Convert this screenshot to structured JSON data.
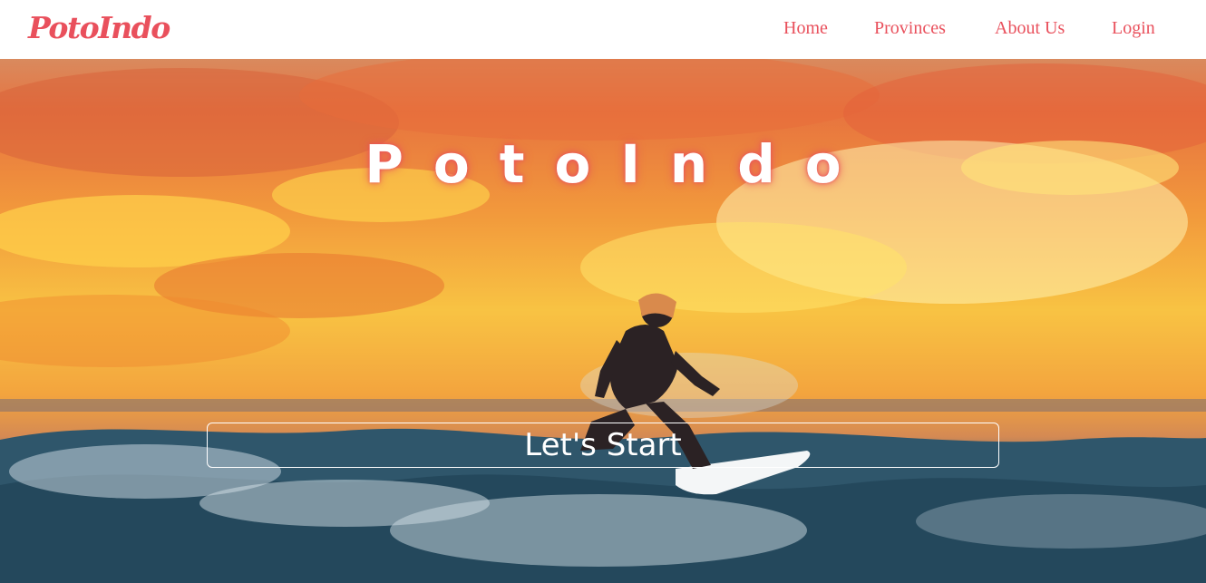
{
  "brand": {
    "logo_text": "PotoIndo"
  },
  "nav": {
    "home": "Home",
    "provinces": "Provinces",
    "about": "About Us",
    "login": "Login"
  },
  "hero": {
    "title": "PotoIndo",
    "button_label": "Let's Start",
    "image_subject": "surfer riding an ocean wave at sunset"
  },
  "colors": {
    "accent": "#e9505c",
    "nav_background": "#ffffff",
    "hero_text": "#ffffff"
  }
}
